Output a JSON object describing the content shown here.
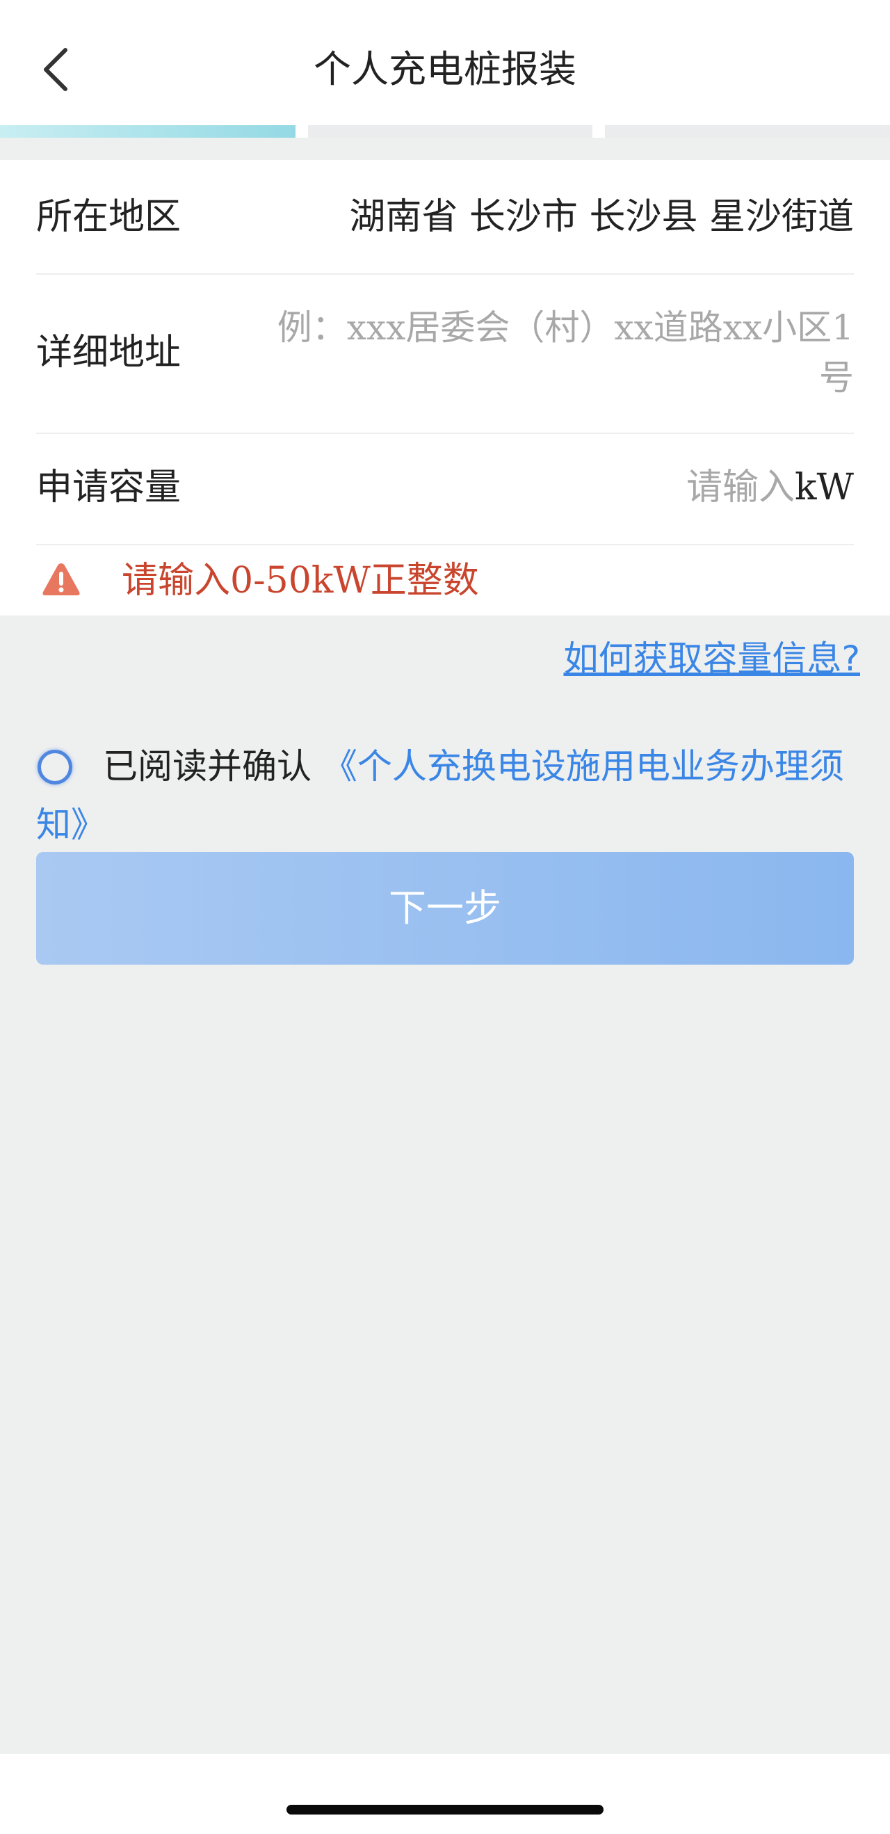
{
  "header": {
    "title": "个人充电桩报装",
    "back_icon": "chevron-left-icon"
  },
  "progress": {
    "steps": 3,
    "current": 1
  },
  "form": {
    "region": {
      "label": "所在地区",
      "value": "湖南省 长沙市 长沙县 星沙街道"
    },
    "address": {
      "label": "详细地址",
      "placeholder": "例：xxx居委会（村）xx道路xx小区1号"
    },
    "capacity": {
      "label": "申请容量",
      "placeholder": "请输入",
      "unit": "kW"
    },
    "error": {
      "icon": "warning-triangle-icon",
      "text": "请输入0-50kW正整数",
      "color": "#c9452e"
    }
  },
  "help_link": "如何获取容量信息?",
  "agreement": {
    "prefix": "已阅读并确认 ",
    "document": "《个人充换电设施用电业务办理须知》",
    "checked": false
  },
  "next_button": "下一步",
  "colors": {
    "accent": "#3a86e6",
    "button": "#9fc2f1",
    "progress": "#94d9e4"
  }
}
